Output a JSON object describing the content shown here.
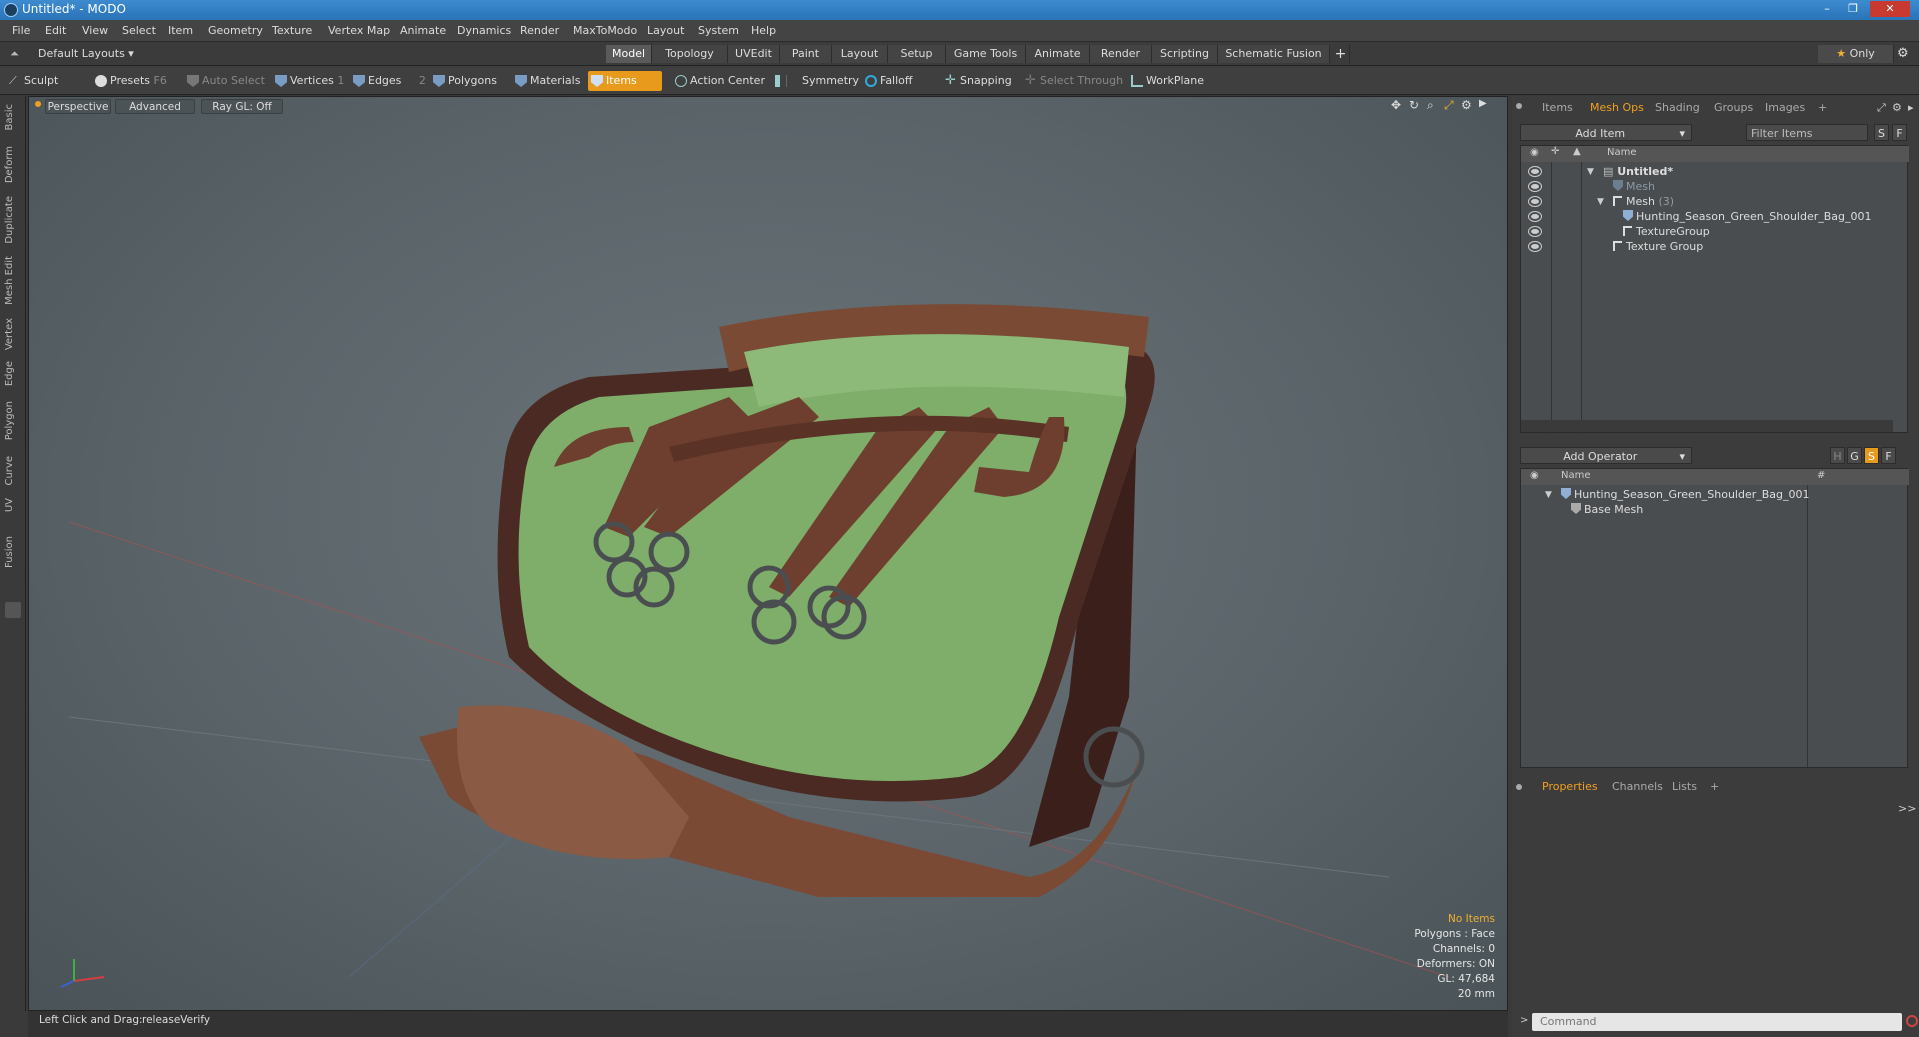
{
  "app": {
    "title": "Untitled* - MODO",
    "window_controls": [
      "–",
      "❐",
      "✕"
    ]
  },
  "menu": [
    "File",
    "Edit",
    "View",
    "Select",
    "Item",
    "Geometry",
    "Texture",
    "Vertex Map",
    "Animate",
    "Dynamics",
    "Render",
    "MaxToModo",
    "Layout",
    "System",
    "Help"
  ],
  "layout": {
    "selector": "Default Layouts ▾",
    "tabs": [
      "Model",
      "Topology",
      "UVEdit",
      "Paint",
      "Layout",
      "Setup",
      "Game Tools",
      "Animate",
      "Render",
      "Scripting",
      "Schematic Fusion"
    ],
    "active_tab": "Model",
    "add": "+",
    "only_label": "Only"
  },
  "toolbar": {
    "sculpt": "Sculpt",
    "presets": "Presets",
    "presets_key": "F6",
    "auto_select": "Auto Select",
    "vertices": "Vertices",
    "vertices_key": "1",
    "edges": "Edges",
    "edges_key": "2",
    "polygons": "Polygons",
    "materials": "Materials",
    "items": "Items",
    "action_center": "Action Center",
    "symmetry": "Symmetry",
    "falloff": "Falloff",
    "snapping": "Snapping",
    "select_through": "Select Through",
    "workplane": "WorkPlane"
  },
  "left_tabs": [
    "Basic",
    "Deform",
    "Duplicate",
    "Mesh Edit",
    "Vertex",
    "Edge",
    "Polygon",
    "Curve",
    "UV",
    "Fusion"
  ],
  "viewport": {
    "view": "Perspective",
    "shading": "Advanced",
    "raygl": "Ray GL: Off",
    "stats": {
      "items": "No Items",
      "polygons": "Polygons : Face",
      "channels": "Channels: 0",
      "deformers": "Deformers: ON",
      "gl": "GL: 47,684",
      "scale": "20 mm"
    }
  },
  "status": {
    "hint": "Left Click and Drag:",
    "action": "releaseVerify"
  },
  "items_panel": {
    "tabs": [
      "Items",
      "Mesh Ops",
      "Shading",
      "Groups",
      "Images",
      "+"
    ],
    "active_tab": "Mesh Ops",
    "add_item": "Add Item",
    "filter": "Filter Items",
    "s": "S",
    "f": "F",
    "col_name": "Name",
    "rows": [
      {
        "label": "Untitled*"
      },
      {
        "label": "Mesh"
      },
      {
        "label": "Mesh",
        "count": "(3)"
      },
      {
        "label": "Hunting_Season_Green_Shoulder_Bag_001"
      },
      {
        "label": "TextureGroup"
      },
      {
        "label": "Texture Group"
      }
    ]
  },
  "mesh_ops": {
    "add_operator": "Add Operator",
    "h": "H",
    "g": "G",
    "s": "S",
    "f": "F",
    "col_name": "Name",
    "col_hash": "#",
    "rows": [
      {
        "label": "Hunting_Season_Green_Shoulder_Bag_001"
      },
      {
        "label": "Base Mesh"
      }
    ]
  },
  "props": {
    "tabs": [
      "Properties",
      "Channels",
      "Lists",
      "+"
    ],
    "active_tab": "Properties",
    "command_placeholder": "Command",
    "expand": ">>"
  },
  "colors": {
    "accent": "#e89a1c",
    "titlebar": "#2a73b8",
    "bag_green": "#7fae6a",
    "leather": "#7a4a35"
  }
}
